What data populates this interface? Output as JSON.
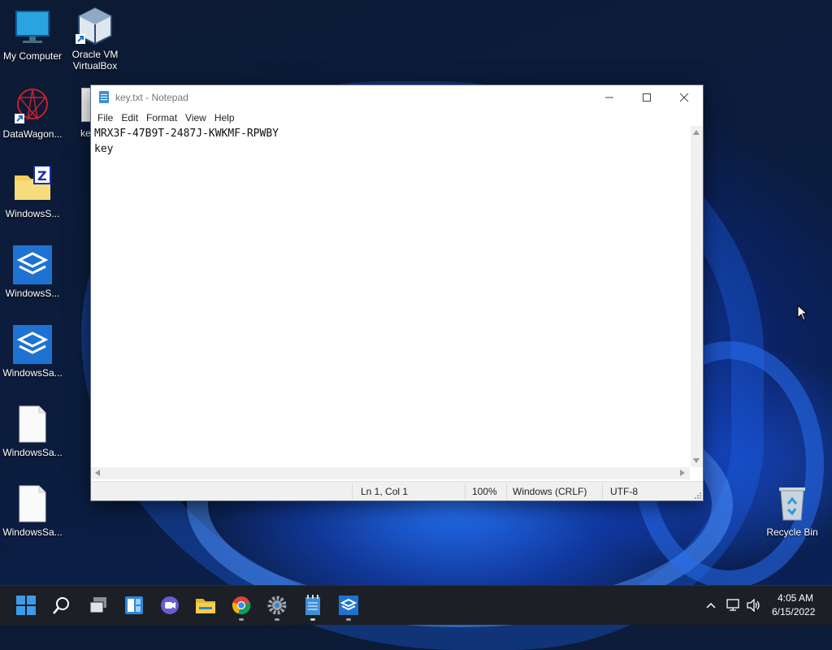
{
  "desktop": {
    "icons": [
      {
        "label": "My Computer",
        "icon": "computer-icon"
      },
      {
        "label": "Oracle VM\nVirtualBox",
        "icon": "virtualbox-icon"
      },
      {
        "label": "DataWagon...",
        "icon": "datawagon-icon"
      },
      {
        "label": "WindowsS...",
        "icon": "zip-folder-icon"
      },
      {
        "label": "WindowsS...",
        "icon": "sandbox-icon"
      },
      {
        "label": "WindowsSa...",
        "icon": "sandbox-icon"
      },
      {
        "label": "WindowsSa...",
        "icon": "file-icon"
      },
      {
        "label": "WindowsSa...",
        "icon": "file-icon"
      },
      {
        "label": "Recycle Bin",
        "icon": "recycle-bin-icon"
      }
    ],
    "partial_label": "ke"
  },
  "notepad": {
    "title": "key.txt - Notepad",
    "menu": [
      "File",
      "Edit",
      "Format",
      "View",
      "Help"
    ],
    "content_lines": [
      "MRX3F-47B9T-2487J-KWKMF-RPWBY",
      "key"
    ],
    "status": {
      "position": "Ln 1, Col 1",
      "zoom": "100%",
      "line_ending": "Windows (CRLF)",
      "encoding": "UTF-8"
    }
  },
  "taskbar": {
    "icons": [
      "windows-start-icon",
      "search-icon",
      "task-view-icon",
      "widgets-icon",
      "chat-icon",
      "file-explorer-icon",
      "chrome-icon",
      "settings-icon",
      "notepad-icon",
      "sandbox-icon"
    ],
    "clock": {
      "time": "4:05 AM",
      "date": "6/15/2022"
    }
  },
  "colors": {
    "accent": "#1e73d2",
    "taskbar": "#1c1f26"
  }
}
